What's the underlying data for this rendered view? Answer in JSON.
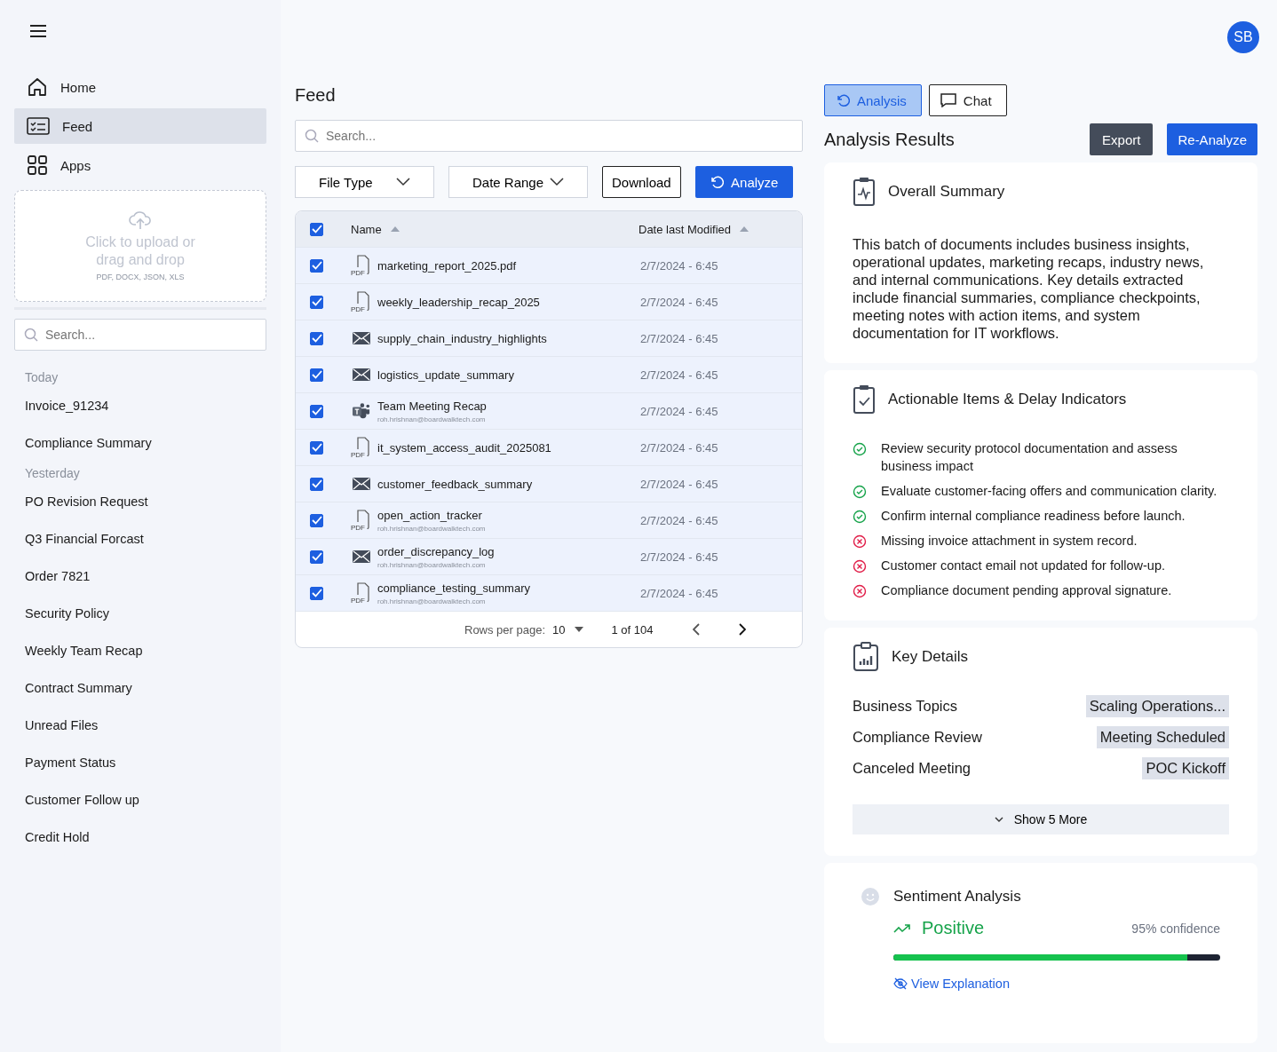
{
  "sidebar": {
    "nav": [
      {
        "label": "Home",
        "selected": false
      },
      {
        "label": "Feed",
        "selected": true
      },
      {
        "label": "Apps",
        "selected": false
      }
    ],
    "upload": {
      "title": "Click to upload or drag and drop",
      "formats": "PDF, DOCX, JSON, XLS"
    },
    "search": {
      "placeholder": "Search..."
    },
    "history": [
      {
        "group": "Today",
        "items": [
          "Invoice_91234",
          "Compliance Summary"
        ]
      },
      {
        "group": "Yesterday",
        "items": [
          "PO Revision Request",
          "Q3 Financial Forcast",
          "Order 7821",
          "Security Policy",
          "Weekly Team Recap",
          "Contract Summary",
          "Unread Files",
          "Payment Status",
          "Customer Follow up",
          "Credit Hold"
        ]
      }
    ]
  },
  "avatar": "SB",
  "feed": {
    "title": "Feed",
    "search": {
      "placeholder": "Search..."
    },
    "filters": [
      "File Type",
      "Date Range"
    ],
    "download": "Download",
    "analyze": "Analyze",
    "table": {
      "all_checked": true,
      "columns": [
        "Name",
        "Date last Modified"
      ],
      "rows": [
        {
          "kind": "pdf",
          "badge": "PDF",
          "name": "marketing_report_2025.pdf",
          "date": "2/7/2024 - 6:45",
          "checked": true
        },
        {
          "kind": "pdf",
          "badge": "PDF",
          "name": "weekly_leadership_recap_2025",
          "date": "2/7/2024 - 6:45",
          "checked": true
        },
        {
          "kind": "mail",
          "name": "supply_chain_industry_highlights",
          "date": "2/7/2024 - 6:45",
          "checked": true
        },
        {
          "kind": "mail",
          "name": "logistics_update_summary",
          "date": "2/7/2024 - 6:45",
          "checked": true
        },
        {
          "kind": "teams",
          "name": "Team Meeting Recap",
          "sender": "roh.hrishnan@boardwalktech.com",
          "date": "2/7/2024 - 6:45",
          "checked": true
        },
        {
          "kind": "pdf",
          "badge": "PDF",
          "name": "it_system_access_audit_2025081",
          "date": "2/7/2024 - 6:45",
          "checked": true
        },
        {
          "kind": "mail",
          "name": "customer_feedback_summary",
          "date": "2/7/2024 - 6:45",
          "checked": true
        },
        {
          "kind": "pdf",
          "badge": "PDF",
          "name": "open_action_tracker",
          "sender": "roh.hrishnan@boardwalktech.com",
          "date": "2/7/2024 - 6:45",
          "checked": true
        },
        {
          "kind": "mail",
          "name": "order_discrepancy_log",
          "sender": "roh.hrishnan@boardwalktech.com",
          "date": "2/7/2024 - 6:45",
          "checked": true
        },
        {
          "kind": "pdf",
          "badge": "PDF",
          "name": "compliance_testing_summary",
          "sender": "roh.hrishnan@boardwalktech.com",
          "date": "2/7/2024 - 6:45",
          "checked": true
        }
      ],
      "rows_per_page_label": "Rows per page:",
      "rows_per_page": "10",
      "page": "1 of 104"
    }
  },
  "analysis": {
    "tabs": [
      {
        "label": "Analysis",
        "selected": true
      },
      {
        "label": "Chat",
        "selected": false
      }
    ],
    "title": "Analysis Results",
    "export": "Export",
    "reanalyze": "Re-Analyze",
    "summary": {
      "title": "Overall Summary",
      "text": "This batch of documents includes business insights, operational updates, marketing recaps, industry news, and internal communications. Key details extracted include financial summaries, compliance checkpoints, meeting notes with action items, and system documentation for IT workflows."
    },
    "actions": {
      "title": "Actionable Items & Delay Indicators",
      "items": [
        {
          "kind": "check",
          "text": "Review security protocol documentation and assess business impact"
        },
        {
          "kind": "check",
          "text": "Evaluate customer-facing offers and communication clarity."
        },
        {
          "kind": "check",
          "text": "Confirm internal compliance readiness before launch."
        },
        {
          "kind": "cross",
          "text": "Missing invoice attachment in system record."
        },
        {
          "kind": "cross",
          "text": "Customer contact email not updated for follow-up."
        },
        {
          "kind": "cross",
          "text": "Compliance document pending approval signature."
        }
      ]
    },
    "key_details": {
      "title": "Key Details",
      "items": [
        {
          "label": "Business Topics",
          "value": "Scaling Operations..."
        },
        {
          "label": "Compliance Review",
          "value": "Meeting Scheduled"
        },
        {
          "label": "Canceled Meeting",
          "value": "POC Kickoff"
        }
      ],
      "more": "Show 5 More"
    },
    "sentiment": {
      "title": "Sentiment Analysis",
      "label": "Positive",
      "confidence": "95% confidence",
      "level": 0.9,
      "link": "View Explanation"
    }
  }
}
